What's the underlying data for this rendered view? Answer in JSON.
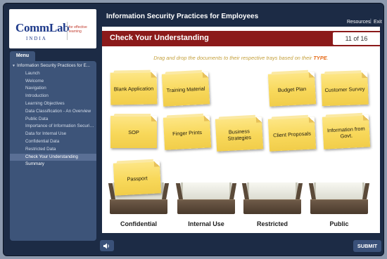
{
  "logo": {
    "brand": "CommLab",
    "brand_sub": "INDIA",
    "tagline": "for effective learning"
  },
  "header": {
    "course_title": "Information Security Practices for Employees",
    "resources": "Resources",
    "separator": "|",
    "exit": "Exit"
  },
  "menu": {
    "tab_label": "Menu",
    "items": [
      {
        "label": "Information Security Practices for E...",
        "level": 0
      },
      {
        "label": "Launch",
        "level": 1
      },
      {
        "label": "Welcome",
        "level": 1
      },
      {
        "label": "Navigation",
        "level": 1
      },
      {
        "label": "Introduction",
        "level": 1
      },
      {
        "label": "Learning Objectives",
        "level": 1
      },
      {
        "label": "Data Classification - An Overview",
        "level": 1
      },
      {
        "label": "Public Data",
        "level": 1
      },
      {
        "label": "Importance of Information Securit...",
        "level": 1
      },
      {
        "label": "Data for Internal Use",
        "level": 1
      },
      {
        "label": "Confidential Data",
        "level": 1
      },
      {
        "label": "Restricted Data",
        "level": 1
      },
      {
        "label": "Check Your Understanding",
        "level": 1,
        "active": true
      },
      {
        "label": "Summary",
        "level": 1
      }
    ]
  },
  "content": {
    "title": "Check Your Understanding",
    "page_counter": "11 of 16",
    "instruction_prefix": "Drag and drop the documents to their respective trays based on their ",
    "instruction_keyword": "TYPE",
    "instruction_suffix": "."
  },
  "documents": [
    "Blank Application",
    "Training Material",
    "Budget Plan",
    "Customer Survey",
    "SOP",
    "Finger Prints",
    "Business Strategies",
    "Client Proposals",
    "Information from Govt.",
    "Passport"
  ],
  "trays": [
    "Confidential",
    "Internal Use",
    "Restricted",
    "Public"
  ],
  "footer": {
    "audio_icon": "speaker-icon",
    "submit": "SUBMIT"
  }
}
